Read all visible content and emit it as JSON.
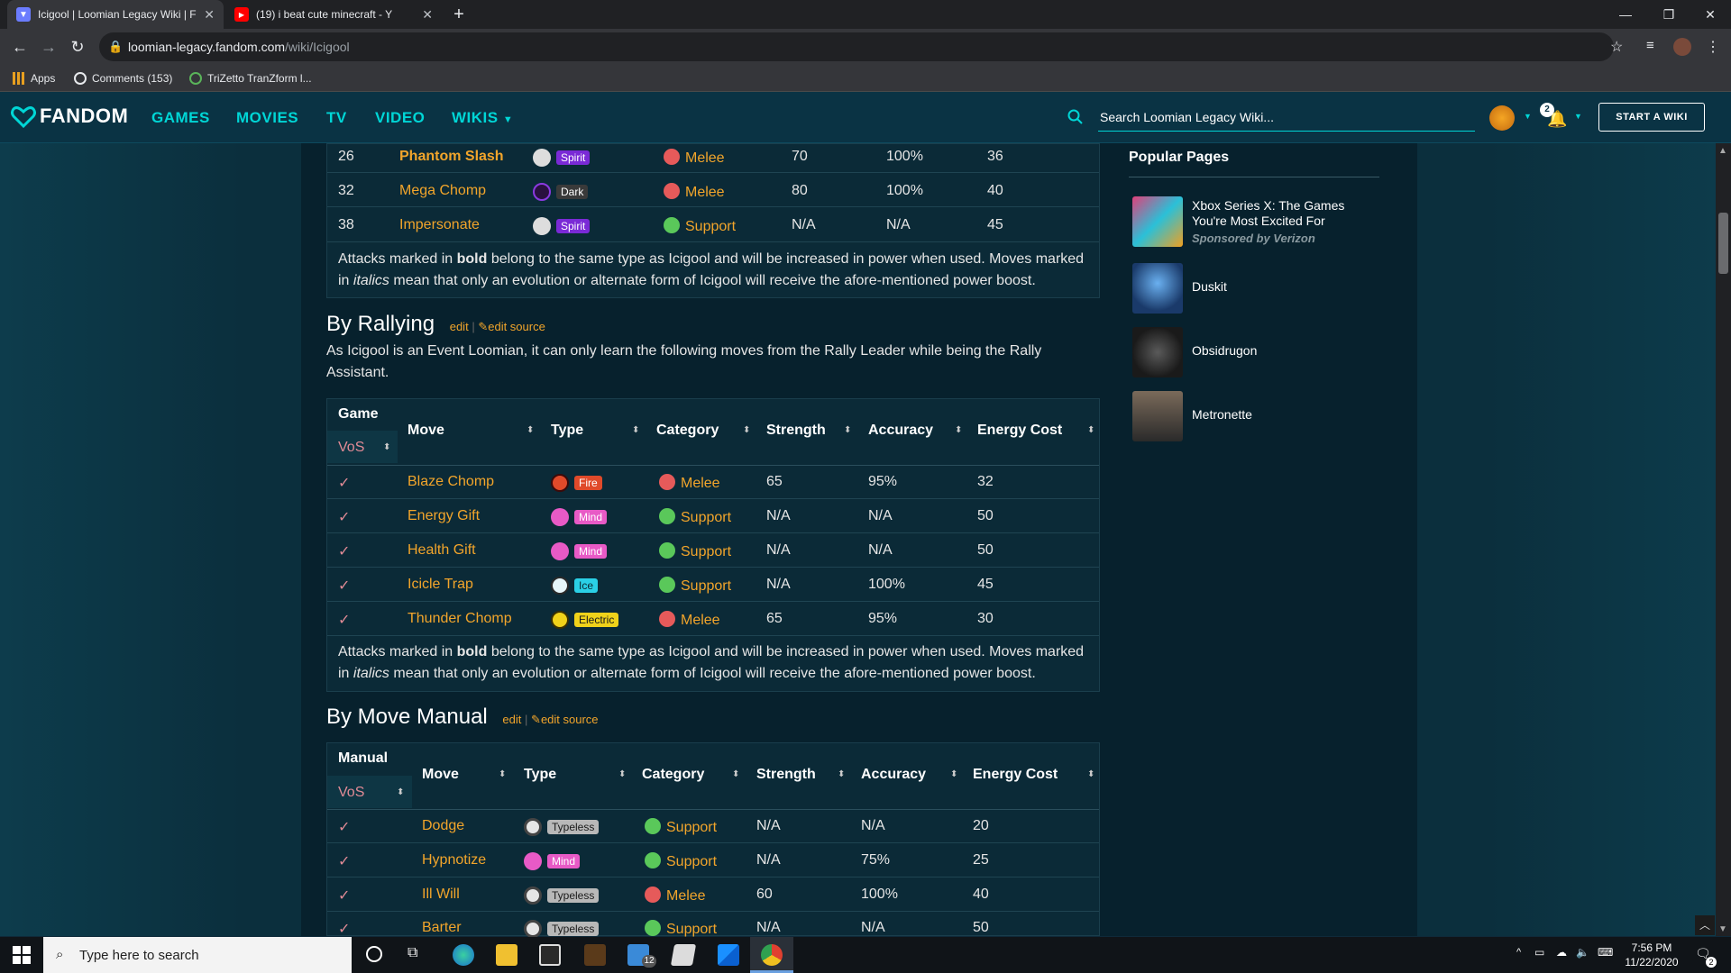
{
  "browser": {
    "tabs": [
      {
        "title": "Icigool | Loomian Legacy Wiki | F"
      },
      {
        "title": "(19) i beat cute minecraft - Y"
      }
    ],
    "url_host": "loomian-legacy.fandom.com",
    "url_path": "/wiki/Icigool",
    "bookmarks": [
      {
        "label": "Apps"
      },
      {
        "label": "Comments (153)"
      },
      {
        "label": "TriZetto TranZform l..."
      }
    ]
  },
  "fandom": {
    "logo": "FANDOM",
    "nav": [
      "GAMES",
      "MOVIES",
      "TV",
      "VIDEO",
      "WIKIS"
    ],
    "search_placeholder": "Search Loomian Legacy Wiki...",
    "notifications_count": "2",
    "start_wiki": "START A WIKI"
  },
  "level_table_tail": {
    "rows": [
      {
        "level": "26",
        "move": "Phantom Slash",
        "bold": true,
        "type": "Spirit",
        "category": "Melee",
        "strength": "70",
        "accuracy": "100%",
        "energy": "36"
      },
      {
        "level": "32",
        "move": "Mega Chomp",
        "bold": false,
        "type": "Dark",
        "category": "Melee",
        "strength": "80",
        "accuracy": "100%",
        "energy": "40"
      },
      {
        "level": "38",
        "move": "Impersonate",
        "bold": false,
        "type": "Spirit",
        "category": "Support",
        "strength": "N/A",
        "accuracy": "N/A",
        "energy": "45"
      }
    ]
  },
  "note": {
    "p1": "Attacks marked in ",
    "bold": "bold",
    "p2": " belong to the same type as Icigool and will be increased in power when used. Moves marked",
    "p3": "in ",
    "italic": "italics",
    "p4": " mean that only an evolution or alternate form of Icigool will receive the afore-mentioned power boost."
  },
  "rallying": {
    "heading": "By Rallying",
    "edit": "edit",
    "edit_source": "edit source",
    "description": "As Icigool is an Event Loomian, it can only learn the following moves from the Rally Leader while being the Rally Assistant.",
    "headers": {
      "game": "Game",
      "game_sub": "VoS",
      "move": "Move",
      "type": "Type",
      "category": "Category",
      "strength": "Strength",
      "accuracy": "Accuracy",
      "energy": "Energy Cost"
    },
    "rows": [
      {
        "check": "✓",
        "move": "Blaze Chomp",
        "type": "Fire",
        "category": "Melee",
        "strength": "65",
        "accuracy": "95%",
        "energy": "32"
      },
      {
        "check": "✓",
        "move": "Energy Gift",
        "type": "Mind",
        "category": "Support",
        "strength": "N/A",
        "accuracy": "N/A",
        "energy": "50"
      },
      {
        "check": "✓",
        "move": "Health Gift",
        "type": "Mind",
        "category": "Support",
        "strength": "N/A",
        "accuracy": "N/A",
        "energy": "50"
      },
      {
        "check": "✓",
        "move": "Icicle Trap",
        "type": "Ice",
        "category": "Support",
        "strength": "N/A",
        "accuracy": "100%",
        "energy": "45"
      },
      {
        "check": "✓",
        "move": "Thunder Chomp",
        "type": "Electric",
        "category": "Melee",
        "strength": "65",
        "accuracy": "95%",
        "energy": "30"
      }
    ]
  },
  "manual": {
    "heading": "By Move Manual",
    "edit": "edit",
    "edit_source": "edit source",
    "headers": {
      "game": "Manual",
      "game_sub": "VoS",
      "move": "Move",
      "type": "Type",
      "category": "Category",
      "strength": "Strength",
      "accuracy": "Accuracy",
      "energy": "Energy Cost"
    },
    "rows": [
      {
        "check": "✓",
        "move": "Dodge",
        "type": "Typeless",
        "category": "Support",
        "strength": "N/A",
        "accuracy": "N/A",
        "energy": "20"
      },
      {
        "check": "✓",
        "move": "Hypnotize",
        "type": "Mind",
        "category": "Support",
        "strength": "N/A",
        "accuracy": "75%",
        "energy": "25"
      },
      {
        "check": "✓",
        "move": "Ill Will",
        "type": "Typeless",
        "category": "Melee",
        "strength": "60",
        "accuracy": "100%",
        "energy": "40"
      },
      {
        "check": "✓",
        "move": "Barter",
        "type": "Typeless",
        "category": "Support",
        "strength": "N/A",
        "accuracy": "N/A",
        "energy": "50"
      }
    ]
  },
  "popular": {
    "title": "Popular Pages",
    "items": [
      {
        "title": "Xbox Series X: The Games You're Most Excited For",
        "sponsor": "Sponsored by Verizon"
      },
      {
        "title": "Duskit"
      },
      {
        "title": "Obsidrugon"
      },
      {
        "title": "Metronette"
      }
    ]
  },
  "taskbar": {
    "search_placeholder": "Type here to search",
    "mail_badge": "12",
    "time": "7:56 PM",
    "date": "11/22/2020",
    "notif_count": "2"
  },
  "colors": {
    "accent": "#00d6d6",
    "link": "#f2a52b",
    "spirit": "#7a2ad6",
    "dark": "#3a3a3a",
    "fire": "#e04a2a",
    "mind": "#e85ac6",
    "ice": "#2ad0e6",
    "electric": "#f0d21a",
    "typeless": "#b8b8b8",
    "melee": "#e65a5a",
    "support": "#5ac85a"
  }
}
